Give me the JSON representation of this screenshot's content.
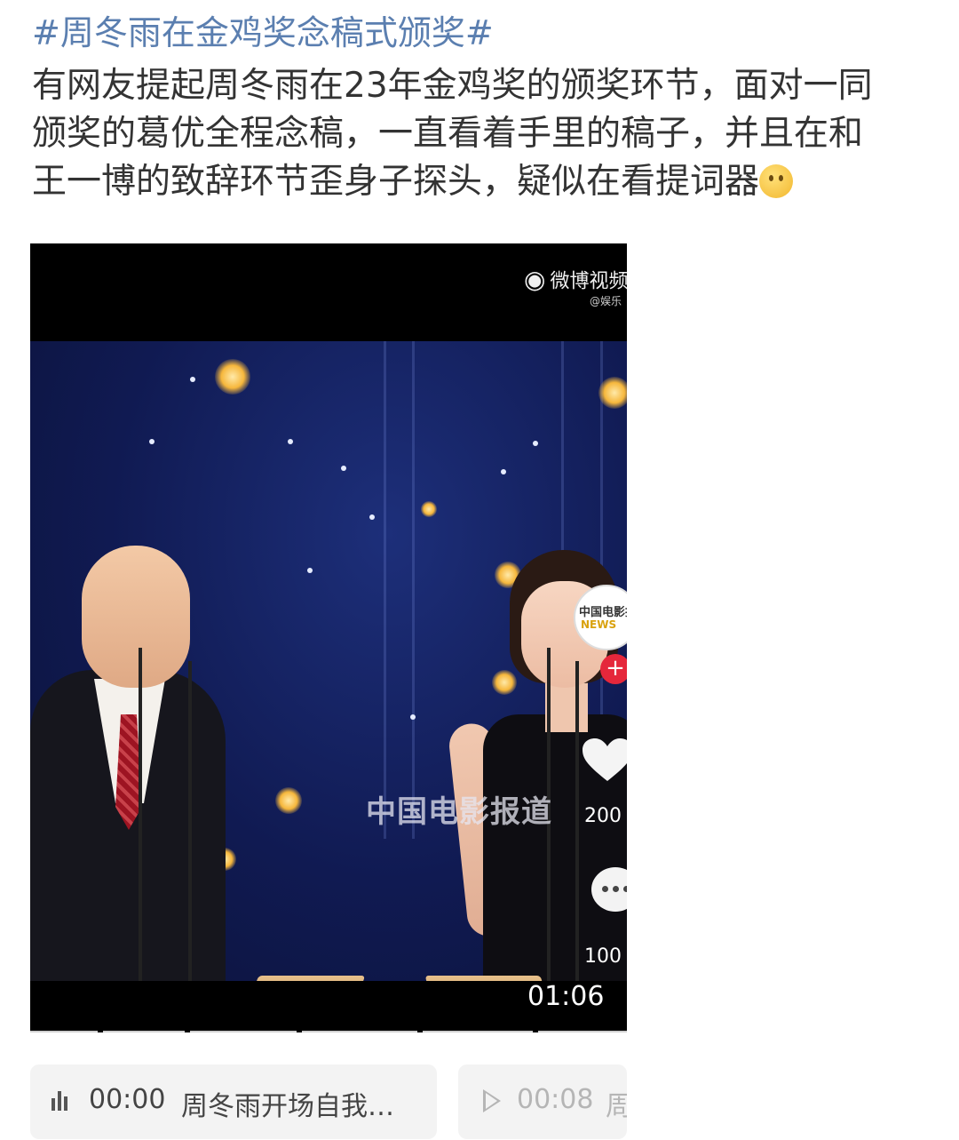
{
  "post": {
    "hashtag": "#周冬雨在金鸡奖念稿式颁奖#",
    "lines": [
      "有网友提起周冬雨在23年金鸡奖的颁奖环节，面对一同",
      "颁奖的葛优全程念稿，一直看着手里的稿子，并且在和",
      "王一博的致辞环节歪身子探头，疑似在看提词器"
    ],
    "emoji": "thinking-face-emoji"
  },
  "video": {
    "platform_badge": "微博视频",
    "platform_sub": "@娱乐",
    "watermark": "中国电影报道",
    "side_avatar_text": "中国电影报",
    "side_avatar_news": "NEWS",
    "follow_symbol": "+",
    "like_count": "200",
    "comment_count": "100",
    "duration": "01:06"
  },
  "chapters": [
    {
      "time": "00:00",
      "title": "周冬雨开场自我…",
      "icon": "audio-bars-icon"
    },
    {
      "time": "00:08",
      "title": "周",
      "icon": "play-icon"
    }
  ],
  "colors": {
    "hashtag": "#5b7fb0",
    "text": "#333333",
    "follow_button": "#e5273b"
  }
}
